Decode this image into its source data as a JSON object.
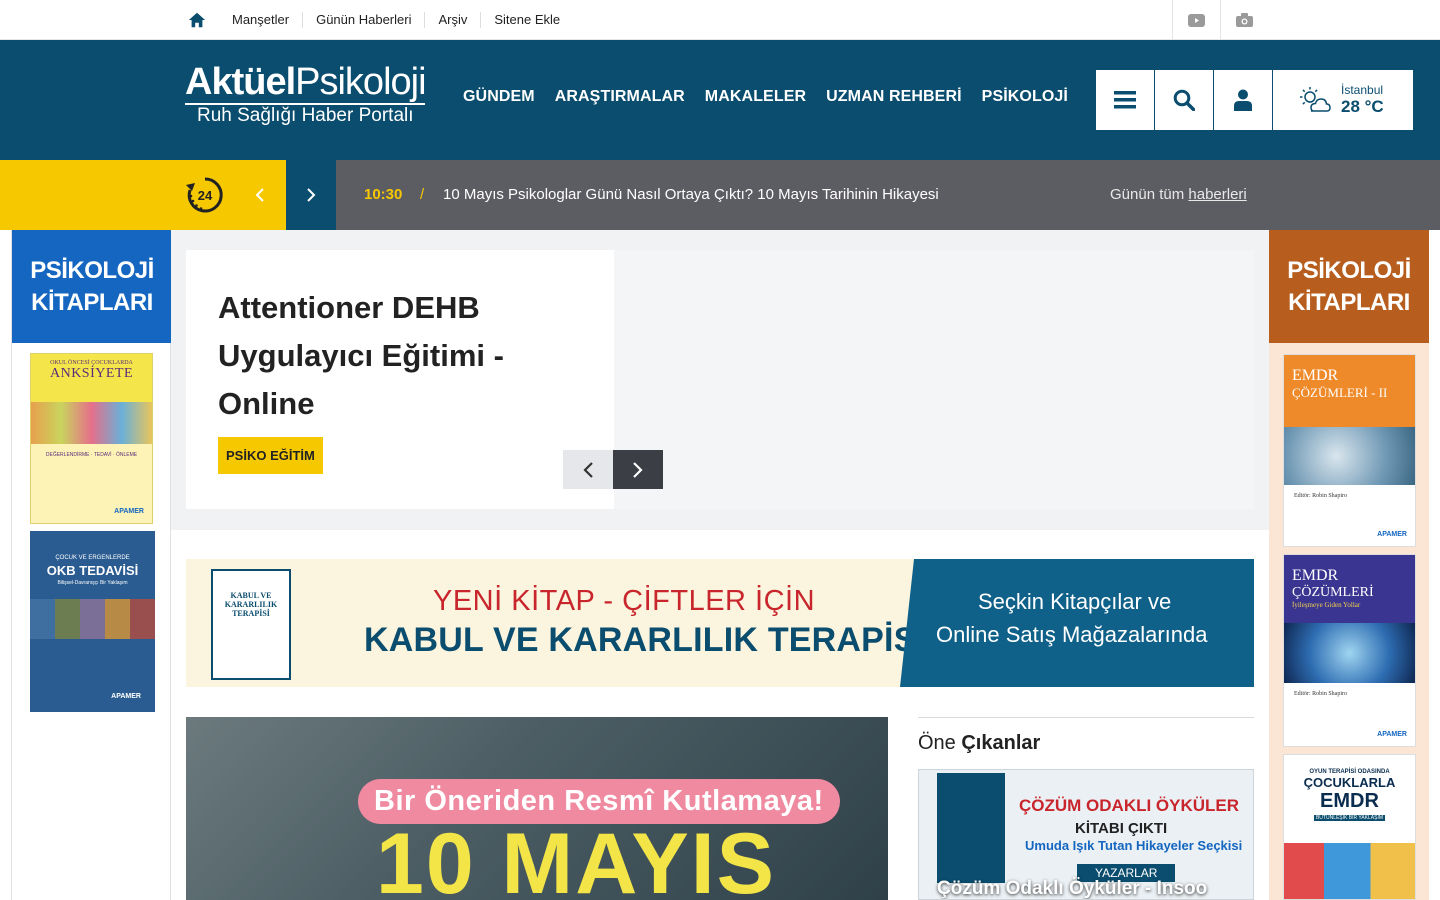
{
  "topbar": {
    "nav": [
      "Manşetler",
      "Günün Haberleri",
      "Arşiv",
      "Sitene Ekle"
    ]
  },
  "header": {
    "logo_bold": "Aktüel",
    "logo_regular": "Psikoloji",
    "logo_tagline": "Ruh Sağlığı Haber Portalı",
    "nav": [
      "GÜNDEM",
      "ARAŞTIRMALAR",
      "MAKALELER",
      "UZMAN REHBERİ",
      "PSİKOLOJİ"
    ],
    "weather_city": "İstanbul",
    "weather_temp": "28 °C"
  },
  "ticker": {
    "clock_label": "24",
    "time": "10:30",
    "separator": "/",
    "headline": "10 Mayıs Psikologlar Günü Nasıl Ortaya Çıktı? 10 Mayıs Tarihinin Hikayesi",
    "all_prefix": "Günün tüm ",
    "all_link": "haberleri"
  },
  "sidebar_left": {
    "heading_line1": "PSİKOLOJİ",
    "heading_line2": "KİTAPLARI",
    "books": [
      {
        "top": "OKUL ÖNCESİ ÇOCUKLARDA",
        "title": "ANKSİYETE",
        "sub": "DEĞERLENDİRME · TEDAVİ · ÖNLEME"
      },
      {
        "top": "ÇOCUK VE ERGENLERDE",
        "title": "OKB TEDAVİSİ",
        "sub": "Bilişsel-Davranışçı Bir Yaklaşım"
      }
    ]
  },
  "sidebar_right": {
    "heading_line1": "PSİKOLOJİ",
    "heading_line2": "KİTAPLARI",
    "books": [
      {
        "title": "EMDR",
        "title2": "ÇÖZÜMLERİ - II",
        "editor": "Editör: Robin Shapiro"
      },
      {
        "title": "EMDR",
        "title2": "ÇÖZÜMLERİ",
        "sub": "İyileşmeye Giden Yollar",
        "editor": "Editör: Robin Shapiro"
      },
      {
        "top": "OYUN TERAPİSİ ODASINDA",
        "title": "ÇOCUKLARLA",
        "title2": "EMDR",
        "sub": "BÜTÜNLEŞİK BİR YAKLAŞIM"
      }
    ]
  },
  "slider": {
    "title": "Attentioner DEHB Uygulayıcı Eğitimi - Online",
    "badge": "PSİKO EĞİTİM"
  },
  "banner": {
    "line1": "YENİ KİTAP - ÇİFTLER İÇİN",
    "line2": "KABUL VE KARARLILIK TERAPİSİ",
    "right1": "Seçkin Kitapçılar ve",
    "right2": "Online Satış Mağazalarında",
    "book_title": "KABUL VE KARARLILIK TERAPİSİ"
  },
  "feature": {
    "pill": "Bir Öneriden Resmî Kutlamaya!",
    "big": "10 MAYIS"
  },
  "one_cikanlar": {
    "title_regular": "Öne ",
    "title_bold": "Çıkanlar",
    "card_line1": "ÇÖZÜM ODAKLI ÖYKÜLER",
    "card_line2": "KİTABI ÇIKTI",
    "card_line3": "Umuda Işık Tutan Hikayeler Seçkisi",
    "card_badge": "YAZARLAR",
    "card_caption": "Çözüm Odaklı Öyküler - Insoo"
  },
  "colors": {
    "brand_blue": "#0a4d6e",
    "yellow": "#f6c800",
    "ticker_gray": "#5c5c63",
    "left_sidebar": "#1466c0",
    "right_sidebar": "#b75e1e"
  }
}
